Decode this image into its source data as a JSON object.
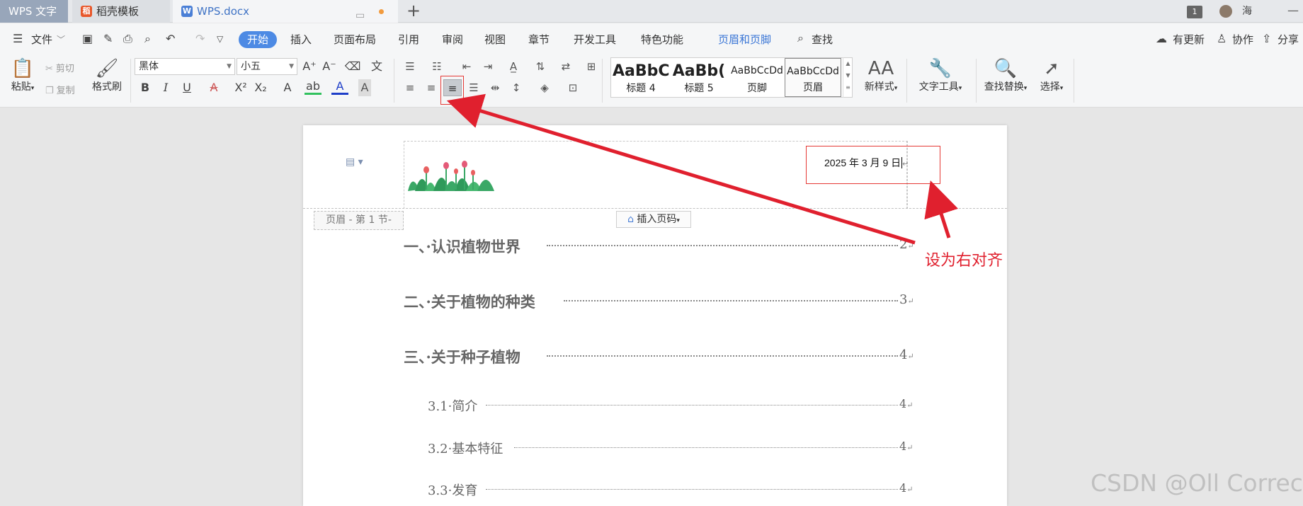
{
  "titlebar": {
    "app_name": "WPS 文字",
    "tabs": [
      {
        "label": "稻壳模板",
        "icon": "docer-icon"
      },
      {
        "label": "WPS.docx",
        "icon": "wps-writer-icon"
      }
    ],
    "new_tab": "+",
    "badge": "1",
    "user_name": "海",
    "minimize": "—"
  },
  "menu": {
    "file": "文件",
    "items": [
      "开始",
      "插入",
      "页面布局",
      "引用",
      "审阅",
      "视图",
      "章节",
      "开发工具",
      "特色功能"
    ],
    "active": "开始",
    "context_tab": "页眉和页脚",
    "search": "查找",
    "right": [
      "有更新",
      "协作",
      "分享"
    ]
  },
  "ribbon": {
    "paste": "粘贴",
    "cut": "剪切",
    "copy": "复制",
    "format_painter": "格式刷",
    "font_family": "黑体",
    "font_size": "小五",
    "styles": [
      {
        "sample": "AaBbC",
        "label": "标题 4"
      },
      {
        "sample": "AaBb(",
        "label": "标题 5"
      },
      {
        "sample": "AaBbCcDd",
        "label": "页脚"
      },
      {
        "sample": "AaBbCcDd",
        "label": "页眉"
      }
    ],
    "new_style": "新样式",
    "text_tools": "文字工具",
    "find_replace": "查找替换",
    "select": "选择"
  },
  "document": {
    "header_date": "2025 年 3 月 9 日",
    "header_tag": "页眉  - 第 1 节-",
    "insert_page_number": "插入页码",
    "toc": [
      {
        "title": "一、·认识植物世界",
        "page": "2",
        "level": 1
      },
      {
        "title": "二、·关于植物的种类",
        "page": "3",
        "level": 1
      },
      {
        "title": "三、·关于种子植物",
        "page": "4",
        "level": 1
      },
      {
        "title": "3.1·简介",
        "page": "4",
        "level": 2
      },
      {
        "title": "3.2·基本特征",
        "page": "4",
        "level": 2
      },
      {
        "title": "3.3·发育",
        "page": "4",
        "level": 2
      }
    ]
  },
  "annotation": {
    "text": "设为右对齐",
    "color": "#e0202e"
  },
  "watermark": "CSDN @Oll Correct",
  "colors": {
    "accent": "#4d8ae4",
    "annotation_red": "#e53935"
  }
}
